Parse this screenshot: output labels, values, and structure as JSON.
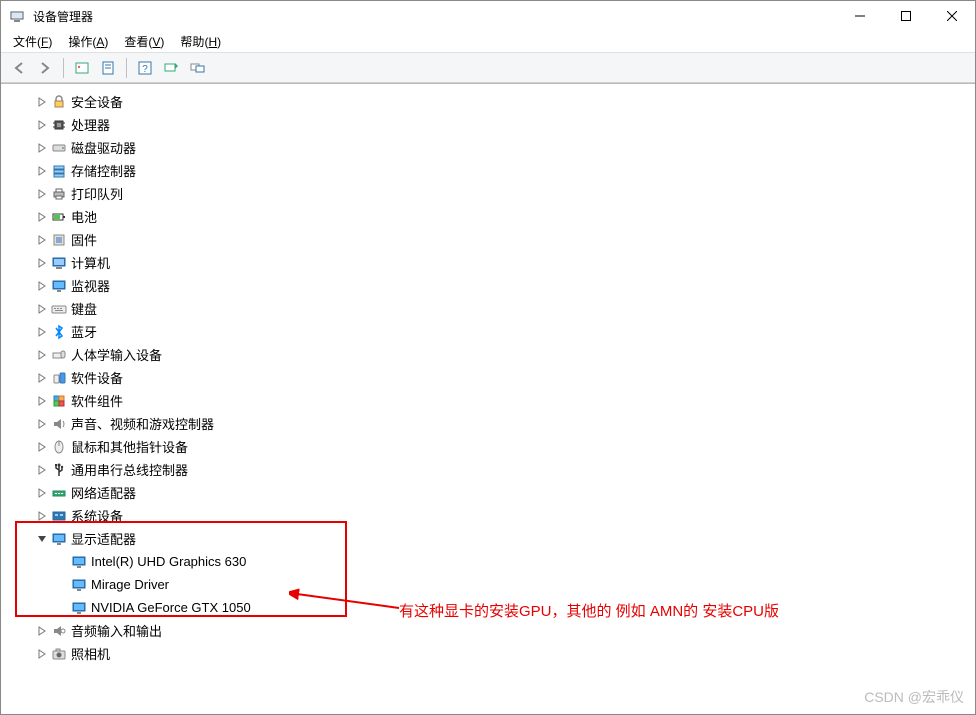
{
  "window": {
    "title": "设备管理器"
  },
  "menubar": {
    "items": [
      {
        "label": "文件",
        "key": "F"
      },
      {
        "label": "操作",
        "key": "A"
      },
      {
        "label": "查看",
        "key": "V"
      },
      {
        "label": "帮助",
        "key": "H"
      }
    ]
  },
  "toolbar": {
    "buttons": [
      {
        "name": "back-icon"
      },
      {
        "name": "forward-icon"
      },
      {
        "sep": true
      },
      {
        "name": "show-hidden-icon"
      },
      {
        "name": "properties-icon"
      },
      {
        "sep": true
      },
      {
        "name": "help-icon"
      },
      {
        "name": "scan-icon"
      },
      {
        "name": "devices-icon"
      }
    ]
  },
  "tree": [
    {
      "level": 1,
      "expand": "closed",
      "icon": "security",
      "label": "安全设备"
    },
    {
      "level": 1,
      "expand": "closed",
      "icon": "processor",
      "label": "处理器"
    },
    {
      "level": 1,
      "expand": "closed",
      "icon": "disk",
      "label": "磁盘驱动器"
    },
    {
      "level": 1,
      "expand": "closed",
      "icon": "storage",
      "label": "存储控制器"
    },
    {
      "level": 1,
      "expand": "closed",
      "icon": "printer",
      "label": "打印队列"
    },
    {
      "level": 1,
      "expand": "closed",
      "icon": "battery",
      "label": "电池"
    },
    {
      "level": 1,
      "expand": "closed",
      "icon": "firmware",
      "label": "固件"
    },
    {
      "level": 1,
      "expand": "closed",
      "icon": "computer",
      "label": "计算机"
    },
    {
      "level": 1,
      "expand": "closed",
      "icon": "monitor",
      "label": "监视器"
    },
    {
      "level": 1,
      "expand": "closed",
      "icon": "keyboard",
      "label": "键盘"
    },
    {
      "level": 1,
      "expand": "closed",
      "icon": "bluetooth",
      "label": "蓝牙"
    },
    {
      "level": 1,
      "expand": "closed",
      "icon": "hid",
      "label": "人体学输入设备"
    },
    {
      "level": 1,
      "expand": "closed",
      "icon": "software",
      "label": "软件设备"
    },
    {
      "level": 1,
      "expand": "closed",
      "icon": "component",
      "label": "软件组件"
    },
    {
      "level": 1,
      "expand": "closed",
      "icon": "audio",
      "label": "声音、视频和游戏控制器"
    },
    {
      "level": 1,
      "expand": "closed",
      "icon": "mouse",
      "label": "鼠标和其他指针设备"
    },
    {
      "level": 1,
      "expand": "closed",
      "icon": "usb",
      "label": "通用串行总线控制器"
    },
    {
      "level": 1,
      "expand": "closed",
      "icon": "network",
      "label": "网络适配器"
    },
    {
      "level": 1,
      "expand": "closed",
      "icon": "system",
      "label": "系统设备"
    },
    {
      "level": 1,
      "expand": "open",
      "icon": "display",
      "label": "显示适配器",
      "highlight": true
    },
    {
      "level": 2,
      "expand": "none",
      "icon": "display",
      "label": "Intel(R) UHD Graphics 630"
    },
    {
      "level": 2,
      "expand": "none",
      "icon": "display",
      "label": "Mirage Driver"
    },
    {
      "level": 2,
      "expand": "none",
      "icon": "display",
      "label": "NVIDIA GeForce GTX 1050"
    },
    {
      "level": 1,
      "expand": "closed",
      "icon": "audioio",
      "label": "音频输入和输出"
    },
    {
      "level": 1,
      "expand": "closed",
      "icon": "camera",
      "label": "照相机"
    }
  ],
  "annotation": {
    "text": "有这种显卡的安装GPU，其他的 例如 AMN的 安装CPU版"
  },
  "watermark": {
    "text": "CSDN @宏乖仪"
  }
}
